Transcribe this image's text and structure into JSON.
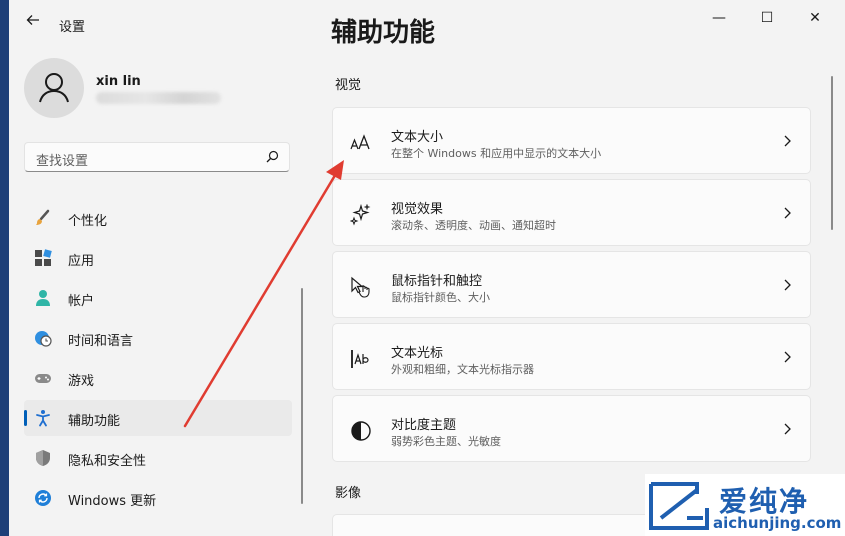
{
  "titlebar": {
    "back_icon": "arrow-left-icon",
    "app_title": "设置",
    "minimize": "—",
    "maximize": "☐",
    "close": "✕"
  },
  "profile": {
    "name": "xin lin"
  },
  "search": {
    "placeholder": "查找设置"
  },
  "nav": {
    "items": [
      {
        "label": "个性化",
        "icon": "paintbrush-icon",
        "active": false
      },
      {
        "label": "应用",
        "icon": "apps-icon",
        "active": false
      },
      {
        "label": "帐户",
        "icon": "person-icon",
        "active": false
      },
      {
        "label": "时间和语言",
        "icon": "globe-clock-icon",
        "active": false
      },
      {
        "label": "游戏",
        "icon": "gamepad-icon",
        "active": false
      },
      {
        "label": "辅助功能",
        "icon": "accessibility-icon",
        "active": true
      },
      {
        "label": "隐私和安全性",
        "icon": "shield-icon",
        "active": false
      },
      {
        "label": "Windows 更新",
        "icon": "update-icon",
        "active": false
      }
    ]
  },
  "main": {
    "page_title": "辅助功能",
    "section_vision": "视觉",
    "cards": [
      {
        "title": "文本大小",
        "subtitle": "在整个 Windows 和应用中显示的文本大小",
        "icon": "text-size-icon"
      },
      {
        "title": "视觉效果",
        "subtitle": "滚动条、透明度、动画、通知超时",
        "icon": "sparkle-icon"
      },
      {
        "title": "鼠标指针和触控",
        "subtitle": "鼠标指针颜色、大小",
        "icon": "mouse-pointer-icon"
      },
      {
        "title": "文本光标",
        "subtitle": "外观和粗细，文本光标指示器",
        "icon": "text-cursor-icon"
      },
      {
        "title": "对比度主题",
        "subtitle": "弱势彩色主题、光敏度",
        "icon": "contrast-icon"
      }
    ],
    "section_media": "影像"
  },
  "watermark": {
    "brand": "爱纯净",
    "url": "aichunjing.com"
  },
  "colors": {
    "accent": "#005fb8",
    "annotation_arrow": "#e03c31",
    "watermark": "#1f5fb0"
  }
}
